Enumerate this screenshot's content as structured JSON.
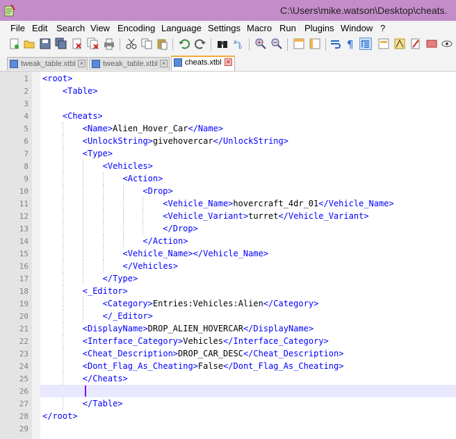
{
  "window": {
    "title": "C:\\Users\\mike.watson\\Desktop\\cheats."
  },
  "menu": [
    "File",
    "Edit",
    "Search",
    "View",
    "Encoding",
    "Language",
    "Settings",
    "Macro",
    "Run",
    "Plugins",
    "Window",
    "?"
  ],
  "toolbar_icons": [
    "new-file-icon",
    "open-file-icon",
    "save-icon",
    "save-all-icon",
    "close-icon",
    "close-all-icon",
    "print-icon",
    "cut-icon",
    "copy-icon",
    "paste-icon",
    "undo-icon",
    "redo-icon",
    "find-icon",
    "replace-icon",
    "zoom-in-icon",
    "zoom-out-icon",
    "sync-vertical-icon",
    "sync-horizontal-icon",
    "word-wrap-icon",
    "show-all-chars-icon",
    "indent-guide-icon",
    "user-language-icon",
    "function-list-icon",
    "doc-map-icon",
    "macro-record-icon",
    "macro-stop-icon",
    "macro-play-icon"
  ],
  "tabs": [
    {
      "label": "tweak_table.xtbl",
      "active": false
    },
    {
      "label": "tweak_table.xtbl",
      "active": false
    },
    {
      "label": "cheats.xtbl",
      "active": true
    }
  ],
  "colors": {
    "titlebar": "#c48cc9",
    "tag": "#0000ff",
    "text": "#000000",
    "caret": "#8000ff",
    "tab_accent": "#f8a838"
  },
  "editor": {
    "lines": [
      {
        "n": "1",
        "indent": 0,
        "tag": "<root>",
        "text": "",
        "close": ""
      },
      {
        "n": "2",
        "indent": 1,
        "tag": "<Table>",
        "text": "",
        "close": ""
      },
      {
        "n": "3",
        "indent": 0,
        "tag": "",
        "text": "",
        "close": ""
      },
      {
        "n": "4",
        "indent": 1,
        "tag": "<Cheats>",
        "text": "",
        "close": ""
      },
      {
        "n": "5",
        "indent": 2,
        "tag": "<Name>",
        "text": "Alien_Hover_Car",
        "close": "</Name>"
      },
      {
        "n": "6",
        "indent": 2,
        "tag": "<UnlockString>",
        "text": "givehovercar",
        "close": "</UnlockString>"
      },
      {
        "n": "7",
        "indent": 2,
        "tag": "<Type>",
        "text": "",
        "close": ""
      },
      {
        "n": "8",
        "indent": 3,
        "tag": "<Vehicles>",
        "text": "",
        "close": ""
      },
      {
        "n": "9",
        "indent": 4,
        "tag": "<Action>",
        "text": "",
        "close": ""
      },
      {
        "n": "10",
        "indent": 5,
        "tag": "<Drop>",
        "text": "",
        "close": ""
      },
      {
        "n": "11",
        "indent": 6,
        "tag": "<Vehicle_Name>",
        "text": "hovercraft_4dr_01",
        "close": "</Vehicle_Name>"
      },
      {
        "n": "12",
        "indent": 6,
        "tag": "<Vehicle_Variant>",
        "text": "turret",
        "close": "</Vehicle_Variant>"
      },
      {
        "n": "13",
        "indent": 6,
        "tag": "</Drop>",
        "text": "",
        "close": ""
      },
      {
        "n": "14",
        "indent": 5,
        "tag": "</Action>",
        "text": "",
        "close": ""
      },
      {
        "n": "15",
        "indent": 4,
        "tag": "<Vehicle_Name>",
        "text": "",
        "close": "</Vehicle_Name>"
      },
      {
        "n": "16",
        "indent": 4,
        "tag": "</Vehicles>",
        "text": "",
        "close": ""
      },
      {
        "n": "17",
        "indent": 3,
        "tag": "</Type>",
        "text": "",
        "close": ""
      },
      {
        "n": "18",
        "indent": 2,
        "tag": "<_Editor>",
        "text": "",
        "close": ""
      },
      {
        "n": "19",
        "indent": 3,
        "tag": "<Category>",
        "text": "Entries:Vehicles:Alien",
        "close": "</Category>"
      },
      {
        "n": "20",
        "indent": 3,
        "tag": "</_Editor>",
        "text": "",
        "close": ""
      },
      {
        "n": "21",
        "indent": 2,
        "tag": "<DisplayName>",
        "text": "DROP_ALIEN_HOVERCAR",
        "close": "</DisplayName>"
      },
      {
        "n": "22",
        "indent": 2,
        "tag": "<Interface_Category>",
        "text": "Vehicles",
        "close": "</Interface_Category>"
      },
      {
        "n": "23",
        "indent": 2,
        "tag": "<Cheat_Description>",
        "text": "DROP_CAR_DESC",
        "close": "</Cheat_Description>"
      },
      {
        "n": "24",
        "indent": 2,
        "tag": "<Dont_Flag_As_Cheating>",
        "text": "False",
        "close": "</Dont_Flag_As_Cheating>"
      },
      {
        "n": "25",
        "indent": 2,
        "tag": "</Cheats>",
        "text": "",
        "close": ""
      },
      {
        "n": "26",
        "indent": 0,
        "tag": "",
        "text": "",
        "close": ""
      },
      {
        "n": "27",
        "indent": 2,
        "tag": "</Table>",
        "text": "",
        "close": ""
      },
      {
        "n": "28",
        "indent": 0,
        "tag": "</root>",
        "text": "",
        "close": ""
      },
      {
        "n": "29",
        "indent": 0,
        "tag": "",
        "text": "",
        "close": ""
      }
    ]
  }
}
